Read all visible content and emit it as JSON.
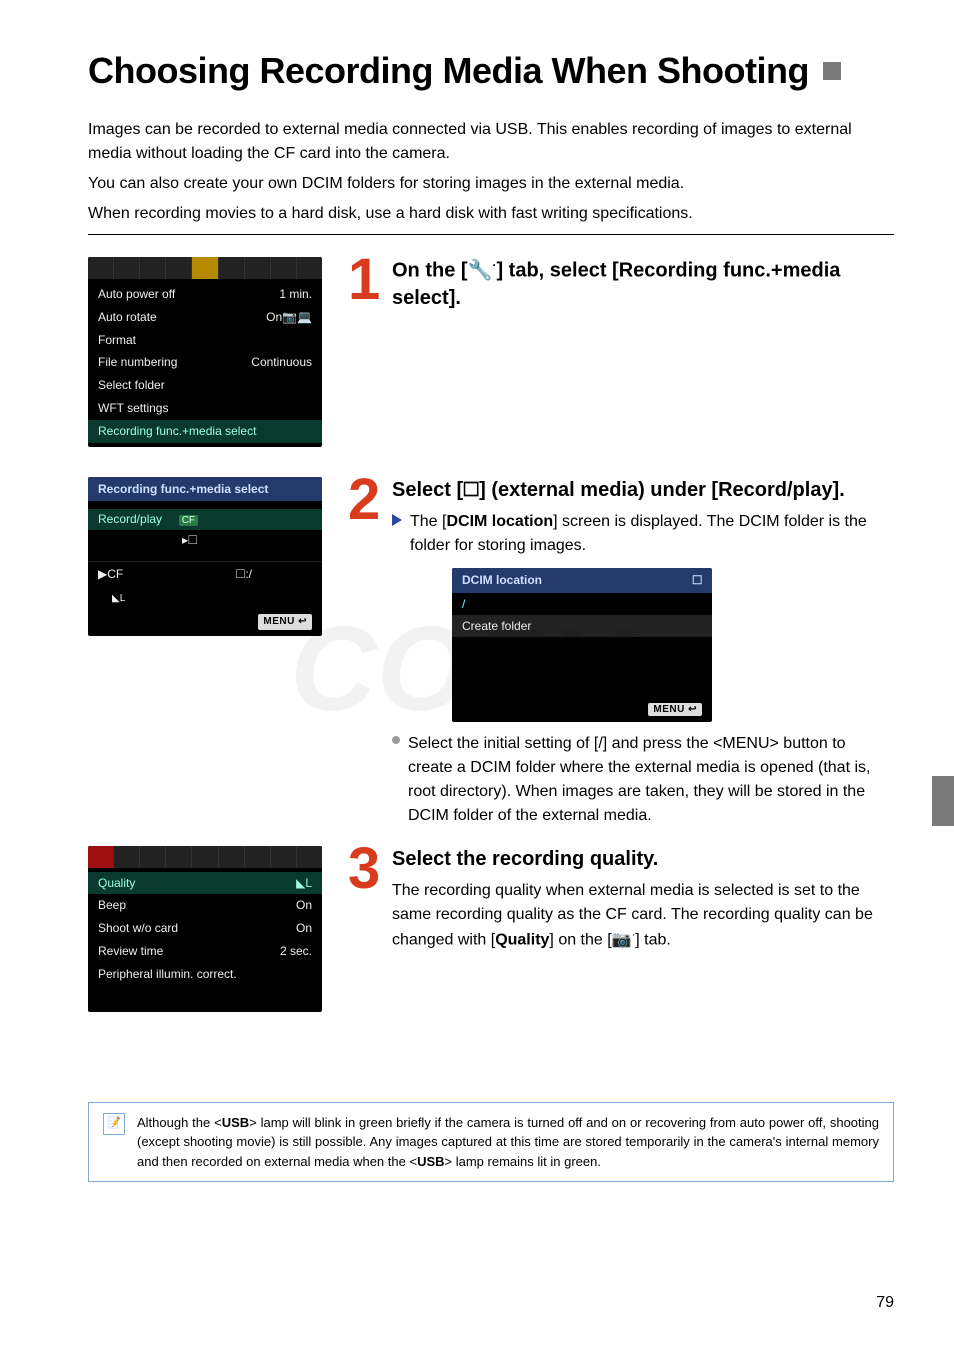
{
  "title": "Choosing Recording Media When Shooting",
  "intro": [
    "Images can be recorded to external media connected via USB. This enables recording of images to external media without loading the CF card into the camera.",
    "You can also create your own DCIM folders for storing images in the external media.",
    "When recording movies to a hard disk, use a hard disk with fast writing specifications."
  ],
  "steps": {
    "s1": {
      "num": "1",
      "head_a": "On the [",
      "head_b": "] tab, select [Recording func.+media select].",
      "wrench_glyph": "🔧",
      "dot_glyph": "·"
    },
    "s2": {
      "num": "2",
      "head": "Select [🞎] (external media) under [Record/play].",
      "bullet1_a": "The [",
      "bullet1_bold": "DCIM location",
      "bullet1_b": "] screen is displayed. The DCIM folder is the folder for storing images.",
      "bullet2": "Select the initial setting of [/] and press the <MENU> button to create a DCIM folder where the external media is opened (that is, root directory). When images are taken, they will be stored in the DCIM folder of the external media."
    },
    "s3": {
      "num": "3",
      "head": "Select the recording quality.",
      "body_a": "The recording quality when external media is selected is set to the same recording quality as the CF card. The recording quality can be changed with [",
      "body_bold": "Quality",
      "body_b": "] on the [",
      "body_c": "] tab.",
      "cam_icon": "📷"
    }
  },
  "cam_menu1": {
    "auto_power_off_l": "Auto power off",
    "auto_power_off_v": "1 min.",
    "auto_rotate_l": "Auto rotate",
    "auto_rotate_v": "On📷💻",
    "format_l": "Format",
    "file_num_l": "File numbering",
    "file_num_v": "Continuous",
    "select_folder_l": "Select folder",
    "wft_l": "WFT settings",
    "recfunc_l": "Recording func.+media select"
  },
  "cam_menu2": {
    "title": "Recording func.+media select",
    "record_play_l": "Record/play",
    "cf_badge": "CF",
    "ext_badge": "▸🞎",
    "row_a": "▶CF",
    "row_b": "🞎:/",
    "menu_badge": "MENU ↩"
  },
  "dcim_screen": {
    "title": "DCIM location",
    "icon": "🞎",
    "slash": "/",
    "create_folder": "Create folder",
    "menu_badge": "MENU ↩"
  },
  "cam_menu3": {
    "quality_l": "Quality",
    "quality_v": "◣L",
    "beep_l": "Beep",
    "beep_v": "On",
    "shoot_l": "Shoot w/o card",
    "shoot_v": "On",
    "review_l": "Review time",
    "review_v": "2 sec.",
    "periph_l": "Peripheral illumin. correct."
  },
  "note": {
    "text_a": "Although the <",
    "usb1": "USB",
    "text_b": "> lamp will blink in green briefly if the camera is turned off and on or recovering from auto power off, shooting (except shooting movie) is still possible. Any images captured at this time are stored temporarily in the camera's internal memory and then recorded on external media when the <",
    "usb2": "USB",
    "text_c": "> lamp remains lit in green.",
    "icon": "📝"
  },
  "page_number": "79",
  "watermark": "COPY"
}
